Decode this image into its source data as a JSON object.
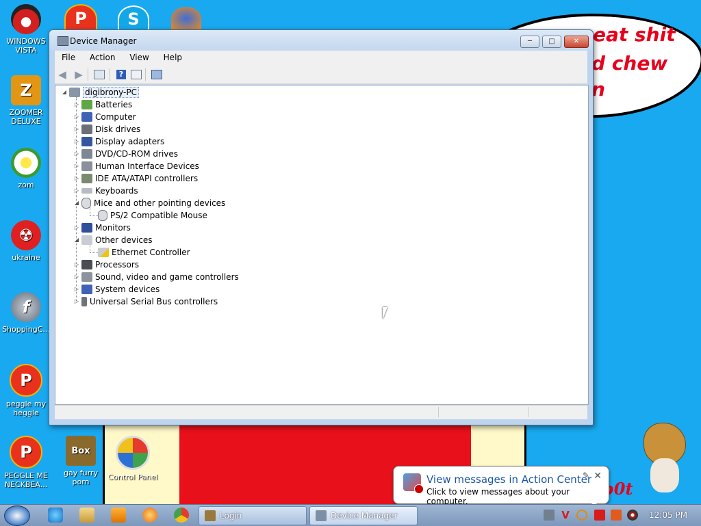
{
  "window": {
    "title": "Device Manager",
    "minimize": "─",
    "maximize": "□",
    "close": "✕"
  },
  "menu": [
    "File",
    "Action",
    "View",
    "Help"
  ],
  "toolbar": [
    "back-icon",
    "forward-icon",
    "console-tree-icon",
    "help-icon",
    "properties-icon",
    "scan-hardware-icon"
  ],
  "tree": {
    "root": "digibrony-PC",
    "nodes": [
      {
        "label": "Batteries",
        "icon": "battery-icon",
        "expanded": false
      },
      {
        "label": "Computer",
        "icon": "computer-icon",
        "expanded": false
      },
      {
        "label": "Disk drives",
        "icon": "disk-drive-icon",
        "expanded": false
      },
      {
        "label": "Display adapters",
        "icon": "display-adapter-icon",
        "expanded": false
      },
      {
        "label": "DVD/CD-ROM drives",
        "icon": "dvd-drive-icon",
        "expanded": false
      },
      {
        "label": "Human Interface Devices",
        "icon": "hid-icon",
        "expanded": false
      },
      {
        "label": "IDE ATA/ATAPI controllers",
        "icon": "ide-controller-icon",
        "expanded": false
      },
      {
        "label": "Keyboards",
        "icon": "keyboard-icon",
        "expanded": false
      },
      {
        "label": "Mice and other pointing devices",
        "icon": "mouse-icon",
        "expanded": true,
        "children": [
          "PS/2 Compatible Mouse"
        ]
      },
      {
        "label": "Monitors",
        "icon": "monitor-icon",
        "expanded": false
      },
      {
        "label": "Other devices",
        "icon": "unknown-device-icon",
        "expanded": true,
        "children": [
          "Ethernet Controller"
        ]
      },
      {
        "label": "Processors",
        "icon": "processor-icon",
        "expanded": false
      },
      {
        "label": "Sound, video and game controllers",
        "icon": "speaker-icon",
        "expanded": false
      },
      {
        "label": "System devices",
        "icon": "system-device-icon",
        "expanded": false
      },
      {
        "label": "Universal Serial Bus controllers",
        "icon": "usb-icon",
        "expanded": false
      }
    ]
  },
  "desktop_icons": [
    {
      "label": "WINDOWS VISTA",
      "icon": "pokeball-icon"
    },
    {
      "label": "ZOOMER DELUXE",
      "icon": "zoomer-icon"
    },
    {
      "label": "zom",
      "icon": "flower-icon"
    },
    {
      "label": "ukraine",
      "icon": "radiation-icon"
    },
    {
      "label": "ShoppingC...",
      "icon": "flash-icon"
    },
    {
      "label": "peggle my heggle",
      "icon": "peggle-icon"
    },
    {
      "label": "PEGGLE ME NECKBEA...",
      "icon": "peggle-icon"
    },
    {
      "label": "gay furry porn",
      "icon": "gopher-box-icon"
    },
    {
      "label": "Control Panel",
      "icon": "control-panel-icon"
    }
  ],
  "desktop_top_icons": [
    "peggle-icon",
    "skype-icon",
    "firefox-icon"
  ],
  "wallpaper_text": [
    "eat shit",
    "d chew",
    "n",
    "b0t"
  ],
  "notification": {
    "title": "View messages in Action Center",
    "body": "Click to view messages about your computer."
  },
  "taskbar": {
    "tasks": [
      {
        "label": "Login",
        "icon": "gopher-icon"
      },
      {
        "label": "Device Manager",
        "icon": "device-manager-icon"
      }
    ],
    "quick_launch": [
      "internet-explorer-icon",
      "explorer-folder-icon",
      "media-player-icon",
      "paint-icon",
      "chrome-icon"
    ],
    "tray": [
      "network-icon",
      "antivirus-icon",
      "search-icon",
      "action-center-flag-icon",
      "display-icon",
      "volume-icon"
    ],
    "clock": "12:05 PM"
  },
  "colors": {
    "desktop_bg": "#19a9f0",
    "wallpaper_red": "#e8101a",
    "window_frame": "#bcd4ee",
    "accent_blue": "#1a55a8"
  }
}
